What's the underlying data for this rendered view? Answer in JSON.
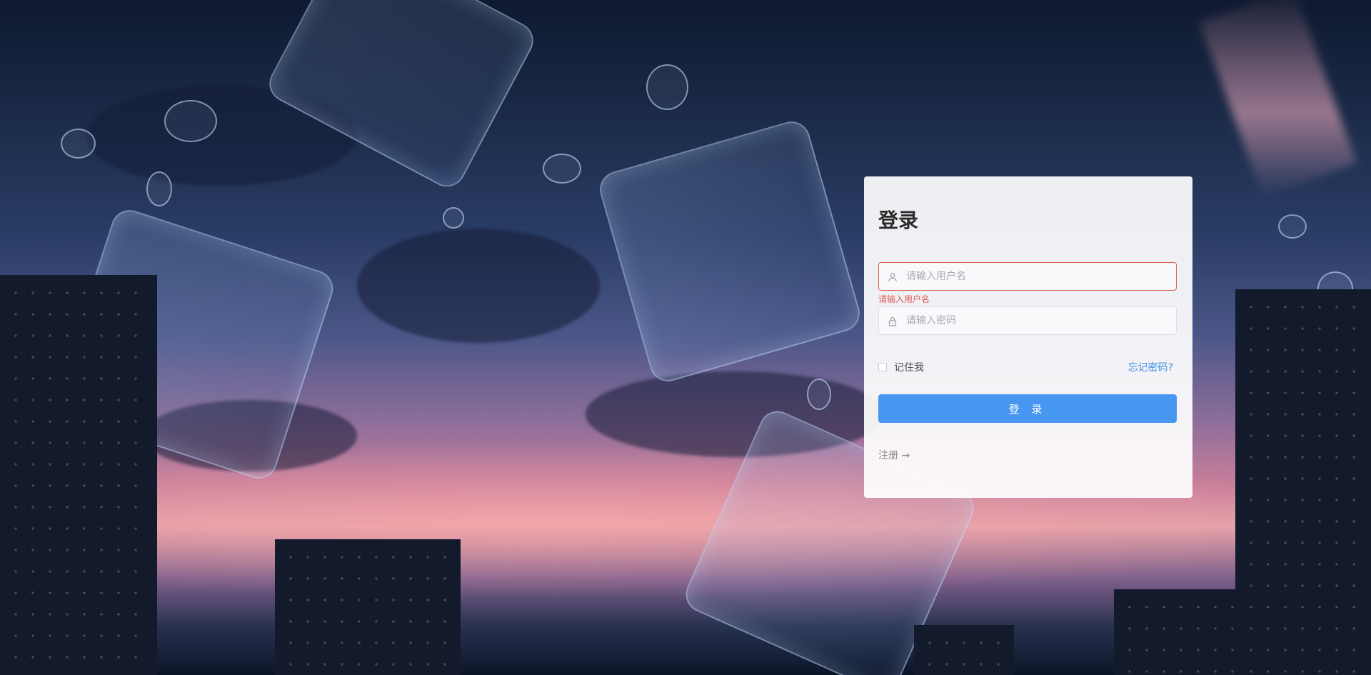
{
  "login": {
    "title": "登录",
    "username": {
      "placeholder": "请输入用户名",
      "value": "",
      "error": "请输入用户名",
      "icon": "user-icon"
    },
    "password": {
      "placeholder": "请输入密码",
      "value": "",
      "icon": "lock-icon"
    },
    "remember_label": "记住我",
    "remember_checked": false,
    "forgot_label": "忘记密码?",
    "submit_label": "登 录",
    "register_label": "注册 →"
  },
  "colors": {
    "accent": "#4796f0",
    "error": "#e05a5a",
    "link": "#3d8fe6"
  }
}
